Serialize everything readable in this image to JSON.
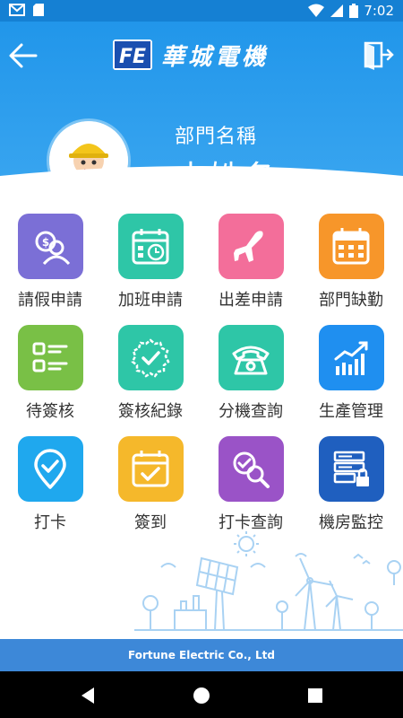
{
  "status_bar": {
    "time": "7:02",
    "icons": [
      "mail-icon",
      "sd-card-icon",
      "wifi-icon",
      "cellular-icon",
      "battery-icon"
    ]
  },
  "header": {
    "company_name": "華城電機",
    "logo_text": "FE",
    "department": "部門名稱",
    "user_name": "中姓名",
    "back_icon": "arrow-left-icon",
    "exit_icon": "exit-door-icon"
  },
  "menu": {
    "items": [
      {
        "label": "請假申請",
        "icon": "leave-request-icon",
        "color": "#7b6fd6"
      },
      {
        "label": "加班申請",
        "icon": "overtime-calendar-icon",
        "color": "#2ec6a7"
      },
      {
        "label": "出差申請",
        "icon": "airplane-icon",
        "color": "#f36e9a"
      },
      {
        "label": "部門缺勤",
        "icon": "calendar-icon",
        "color": "#f7962a"
      },
      {
        "label": "待簽核",
        "icon": "checklist-icon",
        "color": "#79c046"
      },
      {
        "label": "簽核紀錄",
        "icon": "approval-badge-icon",
        "color": "#2ec6a7"
      },
      {
        "label": "分機查詢",
        "icon": "telephone-icon",
        "color": "#2ec6a7"
      },
      {
        "label": "生產管理",
        "icon": "bar-chart-icon",
        "color": "#1f8ff0"
      },
      {
        "label": "打卡",
        "icon": "location-check-icon",
        "color": "#1fa8ee"
      },
      {
        "label": "簽到",
        "icon": "calendar-check-icon",
        "color": "#f5b82b"
      },
      {
        "label": "打卡查詢",
        "icon": "search-check-icon",
        "color": "#9a53c7"
      },
      {
        "label": "機房監控",
        "icon": "server-lock-icon",
        "color": "#1f5fbf"
      }
    ]
  },
  "footer": {
    "text": "Fortune Electric Co., Ltd"
  },
  "nav": {
    "icons": [
      "back-triangle-icon",
      "home-circle-icon",
      "recents-square-icon"
    ]
  }
}
